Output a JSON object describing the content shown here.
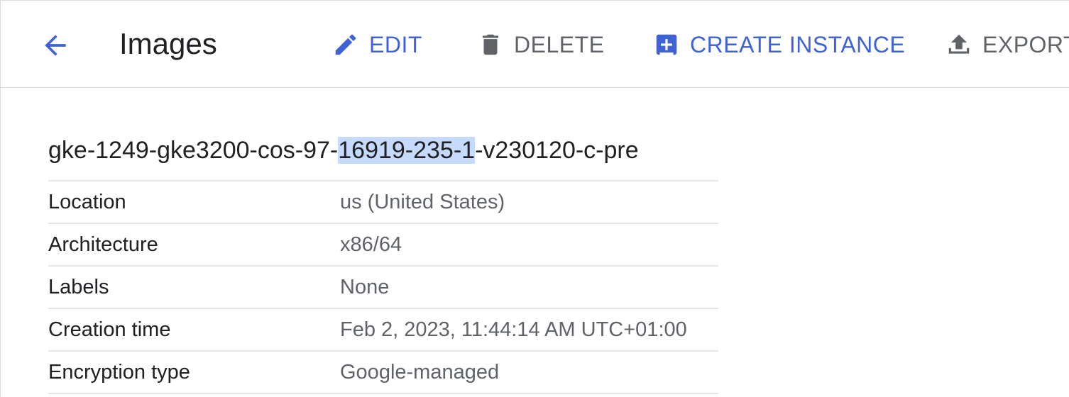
{
  "header": {
    "title": "Images",
    "actions": [
      {
        "label": "EDIT",
        "icon": "pencil-icon",
        "color": "#3f62d4"
      },
      {
        "label": "DELETE",
        "icon": "trash-icon",
        "color": "#5f6368"
      },
      {
        "label": "CREATE INSTANCE",
        "icon": "add-box-icon",
        "color": "#3f62d4"
      },
      {
        "label": "EXPORT",
        "icon": "upload-icon",
        "color": "#5f6368"
      }
    ],
    "back_icon": "arrow-back-icon"
  },
  "image": {
    "name_prefix": "gke-1249-gke3200-cos-97-",
    "name_highlight": "16919-235-1",
    "name_suffix": "-v230120-c-pre",
    "highlight_color": "#c6dbfb"
  },
  "details": [
    {
      "key": "Location",
      "value": "us (United States)"
    },
    {
      "key": "Architecture",
      "value": "x86/64"
    },
    {
      "key": "Labels",
      "value": "None"
    },
    {
      "key": "Creation time",
      "value": "Feb 2, 2023, 11:44:14 AM UTC+01:00"
    },
    {
      "key": "Encryption type",
      "value": "Google-managed"
    }
  ]
}
